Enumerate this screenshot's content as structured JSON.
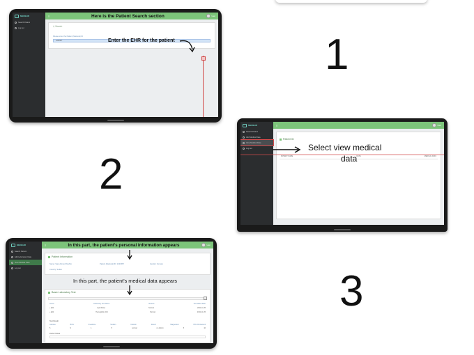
{
  "step1": {
    "number": "1",
    "title": "Here is the Patient Search section",
    "annotation": "Enter the EHR for the patient",
    "logo": "MEDEHR",
    "sidebar": [
      "Search Patient",
      "Log out"
    ],
    "search_heading": "Search",
    "field_label": "Please enter the Patient (National) ID",
    "field_value": "1234567",
    "user": "User"
  },
  "step2": {
    "number": "2",
    "annotation_line1": "Select view medical",
    "annotation_line2": "data",
    "logo": "MEDEHR",
    "sidebar": [
      "Search Patient",
      "Add Medical Data",
      "View Medical Data",
      "Log out"
    ],
    "panel_heading": "Patient ID",
    "row": [
      "PATIENT NAME",
      "DATE",
      "MEDICAL DATA"
    ],
    "user": "User"
  },
  "step3": {
    "number": "3",
    "title": "In this part, the patient's personal information appears",
    "annotation": "In this part, the patient's medical data appears",
    "logo": "MEDEHR",
    "sidebar": [
      "Search Patient",
      "Add Laboratory Data",
      "View Medical Data",
      "Log out"
    ],
    "info_heading": "Patient Information",
    "info_fields": [
      "Name: Sara Ahmed Ibrahim",
      "Patient (National) ID: 1234567",
      "Gender: Female",
      "Country: Sudan"
    ],
    "lab_heading": "Basic Laboratory Test",
    "lab_columns": [
      "Action",
      "Laboratory Test Name",
      "Results",
      "Test added Date"
    ],
    "lab_rows": [
      [
        "+ Edit",
        "Lipid Panel",
        "Normal",
        "2021-11-05"
      ],
      [
        "+ Edit",
        "Hemoglobin A1C",
        "Normal",
        "2021-11-05"
      ]
    ],
    "sub_heading": "Test Result",
    "sub_columns": [
      "Glucose",
      "BUN",
      "Creatinine",
      "Sodium",
      "Calcium",
      "Result",
      "Magnesium",
      "HDL Cholesterol"
    ],
    "sub_row": [
      "5",
      "9",
      "1",
      "5",
      "normal",
      "no Admin",
      "5",
      "10"
    ],
    "notes_label": "Doctor Notes",
    "user": "User"
  }
}
